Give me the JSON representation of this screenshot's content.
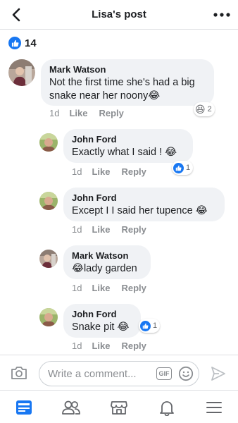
{
  "header": {
    "title": "Lisa's post",
    "back_icon": "chevron-left-icon",
    "more_icon": "more-horizontal-icon"
  },
  "reactions_summary": {
    "icon": "like-icon",
    "count": "14"
  },
  "comments": [
    {
      "author": "Mark Watson",
      "text": "Not the first time she's had a big snake near her noony😂",
      "time": "1d",
      "like_label": "Like",
      "reply_label": "Reply",
      "reaction": {
        "icon": "laughing-face-icon",
        "count": "2"
      }
    },
    {
      "author": "John Ford",
      "text": "Exactly what I said ! 😂",
      "time": "1d",
      "like_label": "Like",
      "reply_label": "Reply",
      "reaction": {
        "icon": "like-icon",
        "count": "1"
      }
    },
    {
      "author": "John Ford",
      "text": "Except I I said her tupence 😂",
      "time": "1d",
      "like_label": "Like",
      "reply_label": "Reply"
    },
    {
      "author": "Mark Watson",
      "text": "😂lady garden",
      "time": "1d",
      "like_label": "Like",
      "reply_label": "Reply"
    },
    {
      "author": "John Ford",
      "text": "Snake pit 😂",
      "time": "1d",
      "like_label": "Like",
      "reply_label": "Reply",
      "reaction": {
        "icon": "like-icon",
        "count": "1"
      }
    }
  ],
  "composer": {
    "placeholder": "Write a comment...",
    "gif_label": "GIF",
    "camera_icon": "camera-icon",
    "emoji_icon": "smiley-icon",
    "send_icon": "send-icon"
  },
  "tabbar": {
    "items": [
      {
        "icon": "news-feed-icon",
        "active": true
      },
      {
        "icon": "friends-icon",
        "active": false
      },
      {
        "icon": "marketplace-icon",
        "active": false
      },
      {
        "icon": "notifications-bell-icon",
        "active": false
      },
      {
        "icon": "menu-icon",
        "active": false
      }
    ]
  },
  "colors": {
    "brand": "#1877f2",
    "bubble": "#f0f2f5",
    "meta_text": "#8a8d91",
    "icon_gray": "#65676b"
  }
}
